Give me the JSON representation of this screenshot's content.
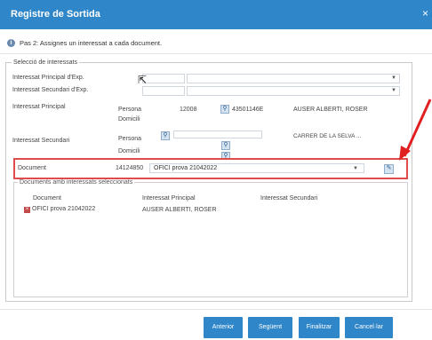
{
  "dialog": {
    "title": "Registre de Sortida",
    "close_glyph": "×",
    "step_icon": "info-icon",
    "step_text": "Pas 2: Assignes un interessat a cada document."
  },
  "section": {
    "legend": "Selecció de interessats",
    "rows": {
      "principal_exp": {
        "label": "Interessat Principal d'Exp."
      },
      "secundari_exp": {
        "label": "Interessat Secundari d'Exp."
      },
      "principal": {
        "label": "Interessat Principal",
        "persona": "Persona",
        "domicili": "Domicili",
        "code": "12008",
        "nif": "43501146E",
        "name": "AUSER ALBERTI, ROSER"
      },
      "secundari": {
        "label": "Interessat Secundari",
        "persona": "Persona",
        "domicili": "Domicili",
        "address": "CARRER DE LA SELVA ..."
      },
      "document": {
        "label": "Document",
        "code": "14124850",
        "value": "OFICI prova 21042022"
      }
    }
  },
  "assigned": {
    "legend": "Documents amb interessats seleccionats",
    "headers": [
      "Document",
      "Interessat Principal",
      "Interessat Secundari"
    ],
    "rows": [
      {
        "document": "OFICI prova 21042022",
        "principal": "AUSER ALBERTI, ROSER",
        "secundari": ""
      }
    ]
  },
  "footer": {
    "buttons": [
      "Anterior",
      "Següent",
      "Finalitzar",
      "Cancel·lar"
    ]
  },
  "colors": {
    "header_blue": "#2f86c8",
    "highlight_red": "#e04b4b"
  }
}
